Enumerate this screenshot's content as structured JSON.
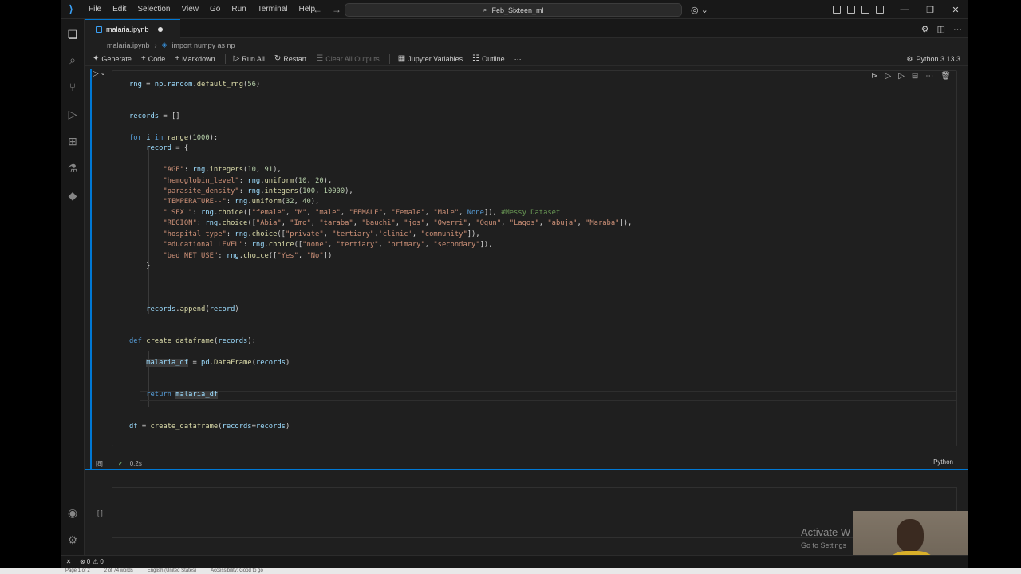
{
  "titlebar": {
    "menu": [
      "File",
      "Edit",
      "Selection",
      "View",
      "Go",
      "Run",
      "Terminal",
      "Help"
    ],
    "search_text": "Feb_Sixteen_ml"
  },
  "tab": {
    "filename": "malaria.ipynb"
  },
  "breadcrumb": {
    "file": "malaria.ipynb",
    "cell": "import numpy as np"
  },
  "toolbar": {
    "generate": "Generate",
    "code": "Code",
    "markdown": "Markdown",
    "run_all": "Run All",
    "restart": "Restart",
    "clear_outputs": "Clear All Outputs",
    "variables": "Jupyter Variables",
    "outline": "Outline",
    "more": "···",
    "kernel": "Python 3.13.3"
  },
  "cell": {
    "execution_count": "[8]",
    "exec_time": "0.2s",
    "language": "Python"
  },
  "cell2": {
    "execution_count": "[ ]"
  },
  "statusbar": {
    "problems": "0",
    "warnings": "0"
  },
  "watermark": {
    "line1": "Activate W",
    "line2": "Go to Settings"
  },
  "taskbar": {
    "page": "Page 1 of 2",
    "words": "2 of 74 words",
    "language": "English (United States)",
    "accessibility": "Accessibility: Good to go"
  },
  "colors": {
    "accent": "#0078d4",
    "background": "#1f1f1f",
    "keyword": "#569cd6",
    "string": "#ce9178",
    "number": "#b5cea8"
  }
}
